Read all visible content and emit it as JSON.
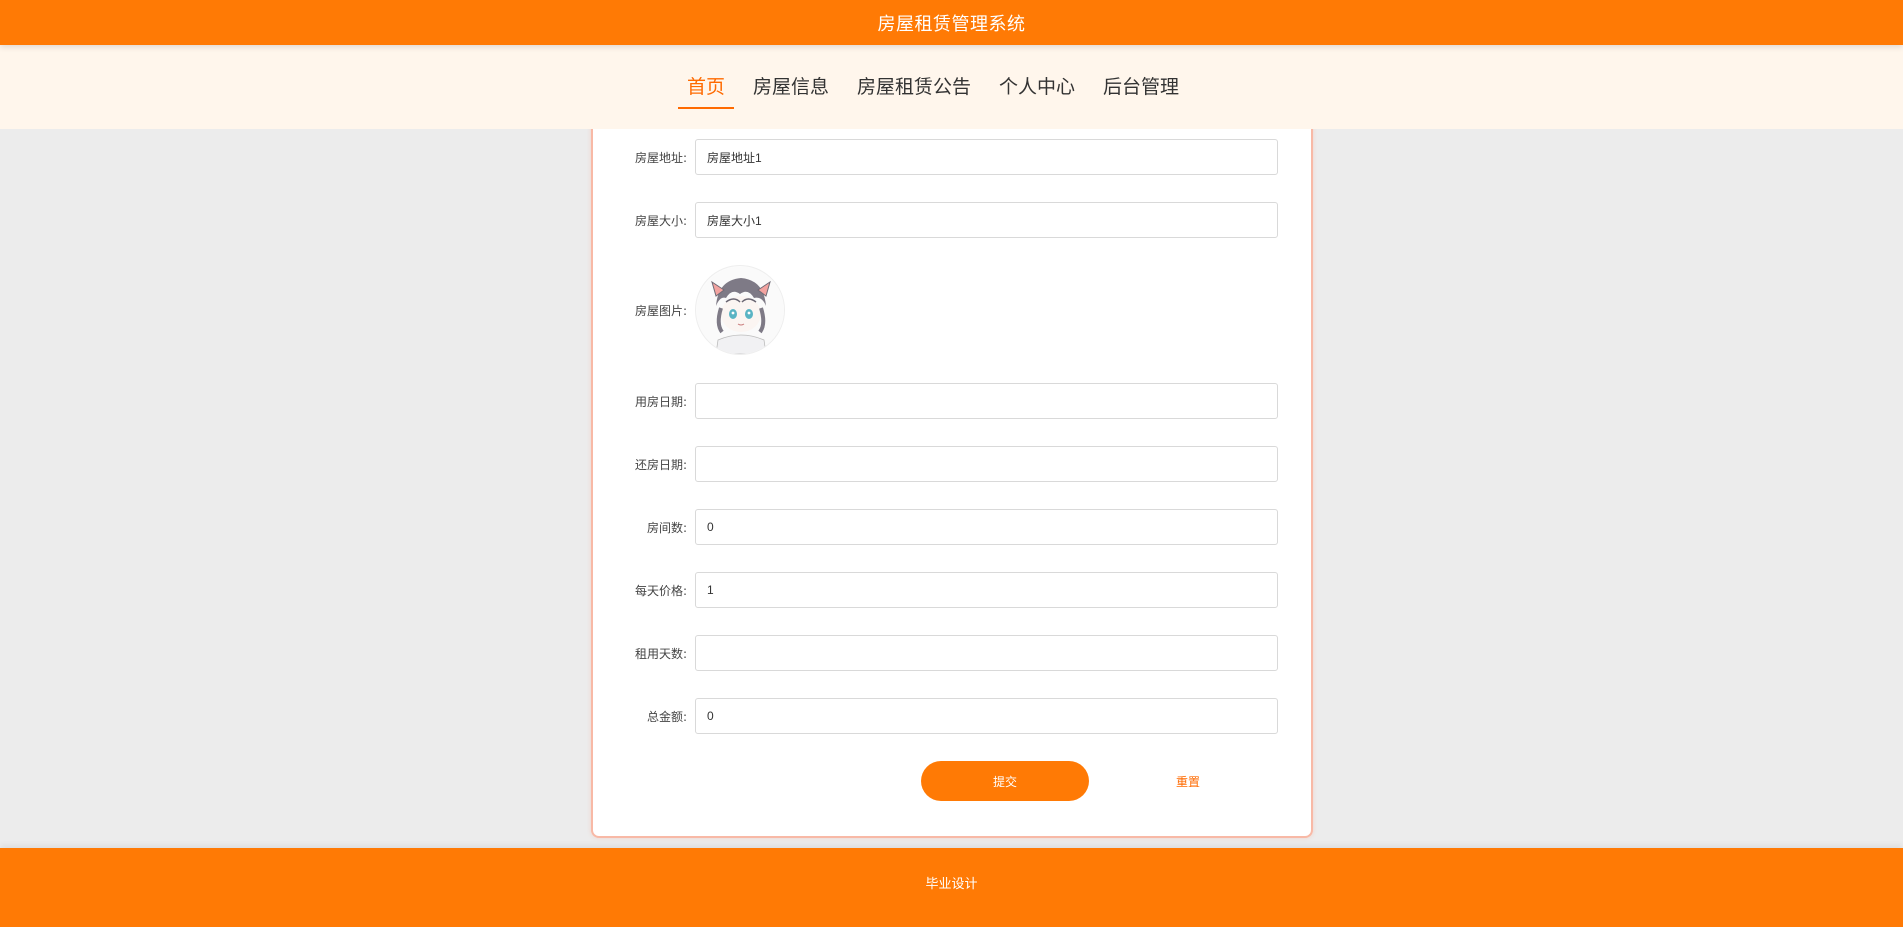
{
  "header": {
    "title": "房屋租赁管理系统"
  },
  "nav": {
    "items": [
      {
        "label": "首页",
        "active": true
      },
      {
        "label": "房屋信息",
        "active": false
      },
      {
        "label": "房屋租赁公告",
        "active": false
      },
      {
        "label": "个人中心",
        "active": false
      },
      {
        "label": "后台管理",
        "active": false
      }
    ]
  },
  "form": {
    "address": {
      "label": "房屋地址:",
      "value": "房屋地址1"
    },
    "size": {
      "label": "房屋大小:",
      "value": "房屋大小1"
    },
    "image": {
      "label": "房屋图片:",
      "icon": "avatar-image"
    },
    "start_date": {
      "label": "用房日期:",
      "value": ""
    },
    "return_date": {
      "label": "还房日期:",
      "value": ""
    },
    "rooms": {
      "label": "房间数:",
      "value": "0"
    },
    "daily_price": {
      "label": "每天价格:",
      "value": "1"
    },
    "days": {
      "label": "租用天数:",
      "value": ""
    },
    "total": {
      "label": "总金额:",
      "value": "0"
    },
    "submit_label": "提交",
    "reset_label": "重置"
  },
  "footer": {
    "text": "毕业设计"
  },
  "colors": {
    "primary": "#ff7a05",
    "nav_bg": "#fff6ec",
    "page_bg": "#ececec",
    "accent": "#ff6a00"
  }
}
